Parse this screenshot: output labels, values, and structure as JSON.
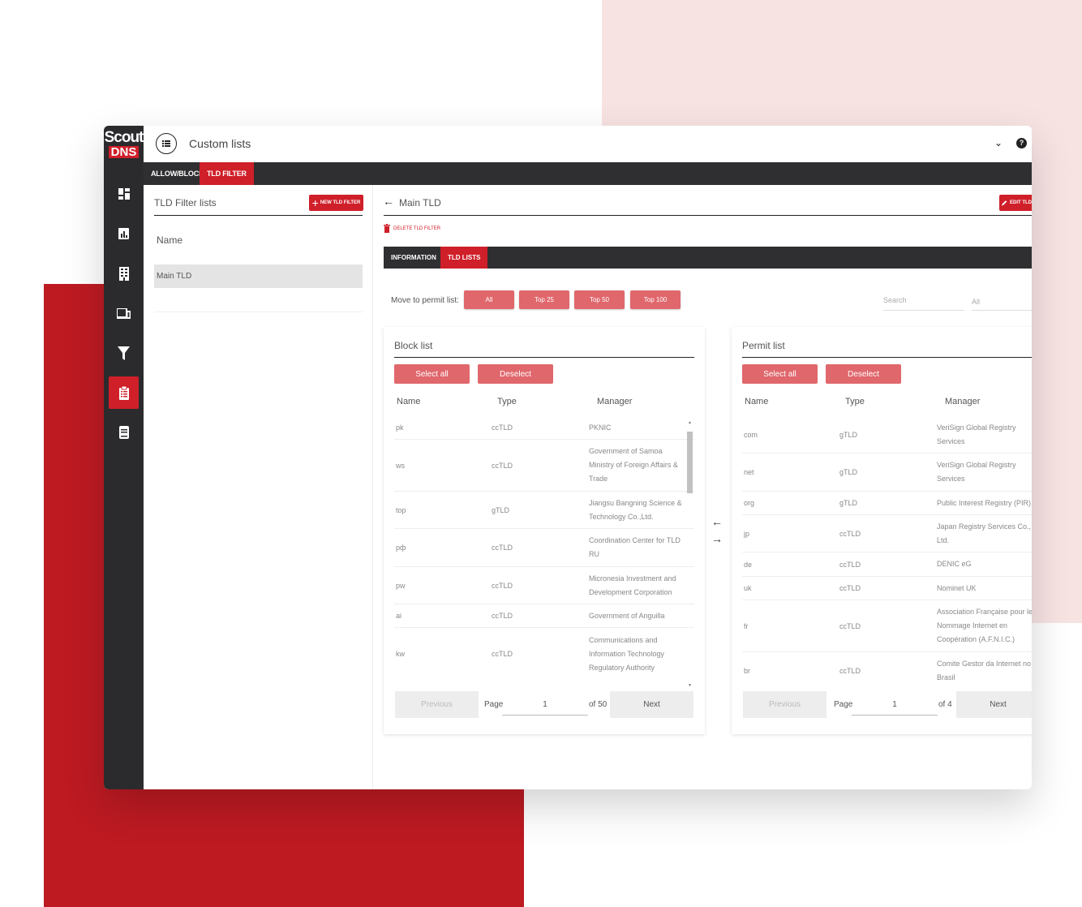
{
  "app": {
    "logo_top": "Scout",
    "logo_bottom": "DNS",
    "page_title": "Custom lists",
    "colors": {
      "accent": "#cf1f29",
      "button_light": "#e0676c",
      "dark_bar": "#2f2f31"
    }
  },
  "sidebar": {
    "icons": [
      "dashboard-icon",
      "reports-icon",
      "building-icon",
      "devices-icon",
      "filter-icon",
      "clipboard-icon",
      "book-icon"
    ],
    "active": "clipboard-icon"
  },
  "tabs": [
    {
      "label": "ALLOW/BLOCK",
      "active": false
    },
    {
      "label": "TLD FILTER",
      "active": true
    }
  ],
  "left": {
    "title": "TLD Filter lists",
    "new_button": "NEW TLD FILTER",
    "column": "Name",
    "items": [
      "Main TLD"
    ]
  },
  "right": {
    "title": "Main TLD",
    "edit_button": "EDIT TLD",
    "delete": "DELETE TLD FILTER",
    "tabs": [
      {
        "label": "INFORMATION",
        "active": false
      },
      {
        "label": "TLD LISTS",
        "active": true
      }
    ],
    "move_label": "Move to permit list:",
    "move_buttons": [
      "All",
      "Top 25",
      "Top 50",
      "Top 100"
    ],
    "search_placeholder": "Search",
    "filter_value": "All"
  },
  "block_list": {
    "title": "Block list",
    "select_all": "Select all",
    "deselect": "Deselect",
    "columns": [
      "Name",
      "Type",
      "Manager"
    ],
    "rows": [
      {
        "name": "pk",
        "type": "ccTLD",
        "manager": "PKNIC"
      },
      {
        "name": "ws",
        "type": "ccTLD",
        "manager": "Government of Samoa Ministry of Foreign Affairs & Trade"
      },
      {
        "name": "top",
        "type": "gTLD",
        "manager": "Jiangsu Bangning Science & Technology Co.,Ltd."
      },
      {
        "name": "рф",
        "type": "ccTLD",
        "manager": "Coordination Center for TLD RU"
      },
      {
        "name": "pw",
        "type": "ccTLD",
        "manager": "Micronesia Investment and Development Corporation"
      },
      {
        "name": "ai",
        "type": "ccTLD",
        "manager": "Government of Anguilla"
      },
      {
        "name": "kw",
        "type": "ccTLD",
        "manager": "Communications and Information Technology Regulatory Authority"
      }
    ],
    "pagination": {
      "previous": "Previous",
      "page_label": "Page",
      "page": "1",
      "of": "of 50",
      "next": "Next"
    }
  },
  "permit_list": {
    "title": "Permit list",
    "select_all": "Select all",
    "deselect": "Deselect",
    "columns": [
      "Name",
      "Type",
      "Manager"
    ],
    "rows": [
      {
        "name": "com",
        "type": "gTLD",
        "manager": "VeriSign Global Registry Services"
      },
      {
        "name": "net",
        "type": "gTLD",
        "manager": "VeriSign Global Registry Services"
      },
      {
        "name": "org",
        "type": "gTLD",
        "manager": "Public Interest Registry (PIR)"
      },
      {
        "name": "jp",
        "type": "ccTLD",
        "manager": "Japan Registry Services Co., Ltd."
      },
      {
        "name": "de",
        "type": "ccTLD",
        "manager": "DENIC eG"
      },
      {
        "name": "uk",
        "type": "ccTLD",
        "manager": "Nominet UK"
      },
      {
        "name": "fr",
        "type": "ccTLD",
        "manager": "Association Française pour le Nommage Internet en Coopération (A.F.N.I.C.)"
      },
      {
        "name": "br",
        "type": "ccTLD",
        "manager": "Comite Gestor da Internet no Brasil"
      }
    ],
    "pagination": {
      "previous": "Previous",
      "page_label": "Page",
      "page": "1",
      "of": "of 4",
      "next": "Next"
    }
  }
}
